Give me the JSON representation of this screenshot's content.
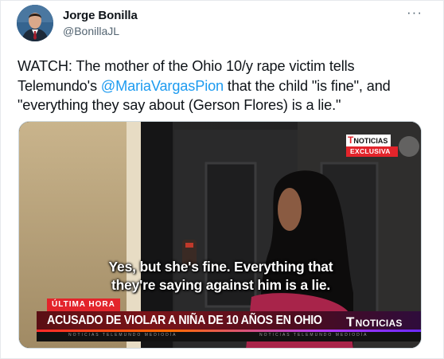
{
  "tweet": {
    "author_name": "Jorge Bonilla",
    "author_handle": "@BonillaJL",
    "more_icon": "more-horizontal-icon",
    "text_part1": "WATCH: The mother of the Ohio 10/y rape victim tells Telemundo's ",
    "mention": "@MariaVargasPion",
    "text_part2": " that the child \"is fine\", and \"everything they say about (Gerson Flores) is a lie.\""
  },
  "video": {
    "badge_brand": "NOTICIAS",
    "badge_exclusive": "EXCLUSIVA",
    "subtitle_line1": "Yes, but she's fine. Everything that",
    "subtitle_line2": "they're saying against him is a lie.",
    "breaking_label": "ÚLTIMA HORA",
    "headline": "ACUSADO DE VIOLAR A NIÑA DE 10 AÑOS EN OHIO",
    "channel_logo": "NOTICIAS",
    "ticker_left": "NOTICIAS TELEMUNDO MEDIODÍA",
    "ticker_right": "NOTICIAS TELEMUNDO MEDIODÍA"
  },
  "colors": {
    "mention": "#1d9bf0",
    "breaking_red": "#e3242b",
    "secondary_text": "#536471"
  }
}
